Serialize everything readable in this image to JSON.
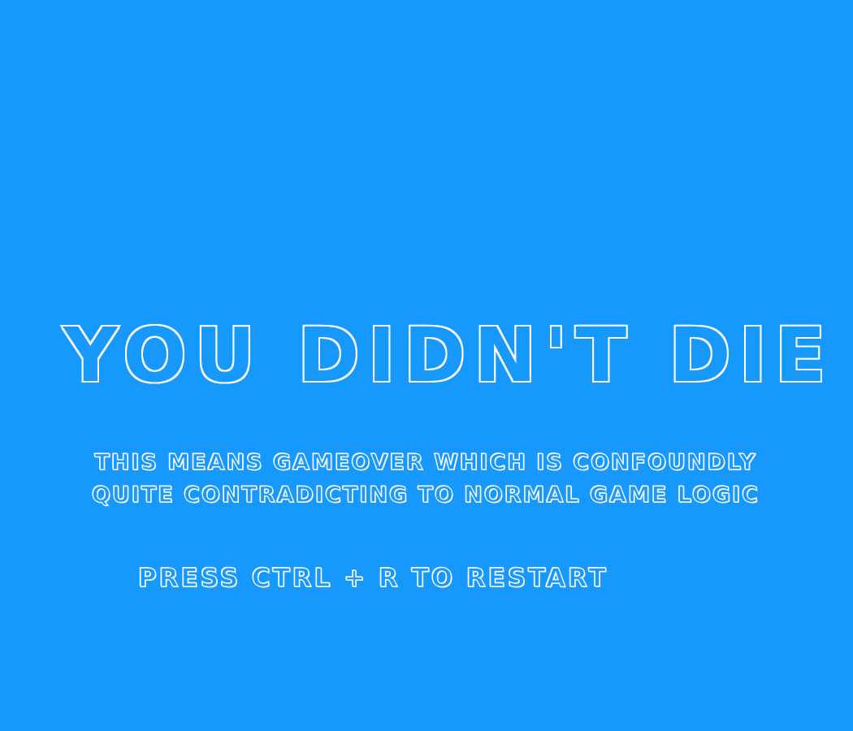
{
  "screen": {
    "background_color": "#1798fd",
    "text_color": "#ffffff"
  },
  "title": "YOU DIDN'T DIE",
  "subtitle": {
    "line1": "THIS MEANS GAMEOVER WHICH IS CONFOUNDLY",
    "line2": "QUITE CONTRADICTING  TO NORMAL GAME LOGIC"
  },
  "restart_hint": "PRESS CTRL + R TO RESTART"
}
